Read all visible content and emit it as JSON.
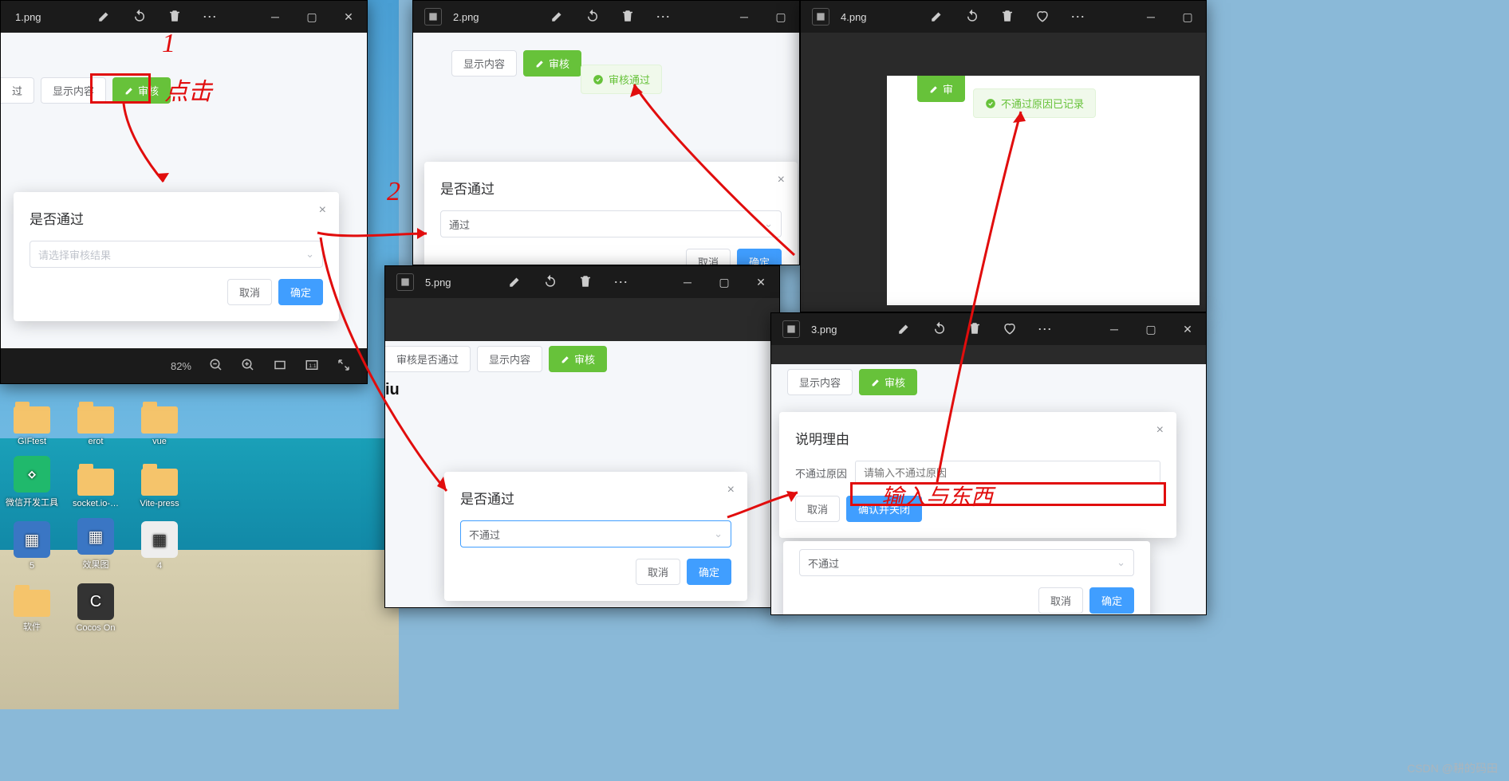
{
  "desktop": {
    "icons": [
      "GIFtest",
      "erot",
      "vue",
      "微信开发工具",
      "socket.io-…",
      "Vite-press",
      "5",
      "效果图",
      "4",
      "软件",
      "Cocos On"
    ]
  },
  "windows": {
    "w1": {
      "filename": "1.png",
      "zoom": "82%",
      "toolbar": {
        "btn_show": "显示内容",
        "btn_audit": "审核",
        "btn_pass_hint": "过"
      },
      "dialog": {
        "title": "是否通过",
        "placeholder": "请选择审核结果",
        "cancel": "取消",
        "ok": "确定"
      }
    },
    "w2": {
      "filename": "2.png",
      "toolbar": {
        "btn_show": "显示内容",
        "btn_audit": "审核"
      },
      "toast": "审核通过",
      "dialog": {
        "title": "是否通过",
        "selected": "通过",
        "cancel": "取消",
        "ok": "确定"
      }
    },
    "w5": {
      "filename": "5.png",
      "toolbar": {
        "btn_tag": "审核是否通过",
        "btn_show": "显示内容",
        "btn_audit": "审核"
      },
      "text_frag": "iu",
      "dialog": {
        "title": "是否通过",
        "selected": "不通过",
        "cancel": "取消",
        "ok": "确定"
      }
    },
    "w4": {
      "filename": "4.png",
      "toolbar": {
        "btn_audit_frag": "审"
      },
      "toast": "不通过原因已记录"
    },
    "w3": {
      "filename": "3.png",
      "toolbar": {
        "btn_show": "显示内容",
        "btn_audit": "审核"
      },
      "reason_dialog": {
        "title": "说明理由",
        "label": "不通过原因",
        "placeholder": "请输入不通过原因",
        "cancel": "取消",
        "confirm": "确认并关闭"
      },
      "pass_dialog": {
        "selected": "不通过",
        "cancel": "取消",
        "ok": "确定"
      }
    }
  },
  "annotations": {
    "n1": "1",
    "n2": "2",
    "click": "点击",
    "input": "输入与东西"
  },
  "watermark": "CSDN @耕的码田"
}
